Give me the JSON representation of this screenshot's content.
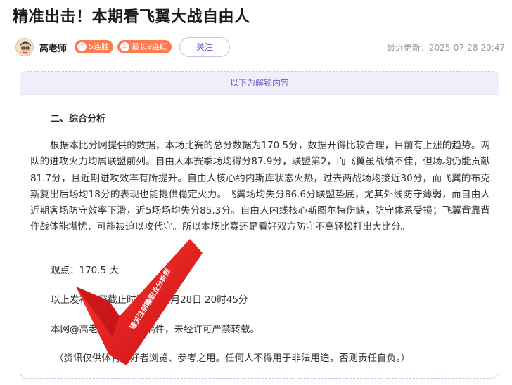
{
  "header": {
    "title": "精准出击！本期看飞翼大战自由人"
  },
  "author": {
    "name": "高老师",
    "streak_badge": "5连胜",
    "longest_badge": "最长9连红",
    "follow_label": "关注",
    "updated": "最近更新：2025-07-28 20:47"
  },
  "locked": {
    "header": "以下为解锁内容"
  },
  "article": {
    "section_title": "二、综合分析",
    "paragraph": "根据本比分网提供的数据，本场比赛的总分数据为170.5分，数据开得比较合理，目前有上涨的趋势。两队的进攻火力均属联盟前列。自由人本赛季场均得分87.9分，联盟第2，而飞翼虽战绩不佳，但场均仍能贡献81.7分，且近期进攻效率有所提升。自由人核心约内斯库状态火热，过去两战场均接近30分，而飞翼的布克斯复出后场均18分的表现也能提供稳定火力。飞翼场均失分86.6分联盟垫底，尤其外线防守薄弱，而自由人近期客场防守效率下滑，近5场场均失分85.3分。自由人内线核心斯图尔特伤缺，防守体系受损；飞翼背靠背作战体能堪忧，可能被迫以攻代守。所以本场比赛还是看好双方防守不高轻松打出大比分。",
    "viewpoint": "观点：170.5 大",
    "deadline": "以上发布内容截止时间为：7月28日 20时45分",
    "copyright": "本网@高老师原创独家稿件，未经许可严禁转载。",
    "disclaimer": "（资讯仅供体育爱好者浏览、参考之用。任何人不得用于非法用途，否则责任自负。）"
  },
  "watermark": {
    "text": "请关注前瞻职业分析师"
  },
  "colors": {
    "accent": "#6a5bd0",
    "badge": "#ff7a4d",
    "locked_bg": "#f1eefb",
    "watermark": "#e3161e"
  }
}
